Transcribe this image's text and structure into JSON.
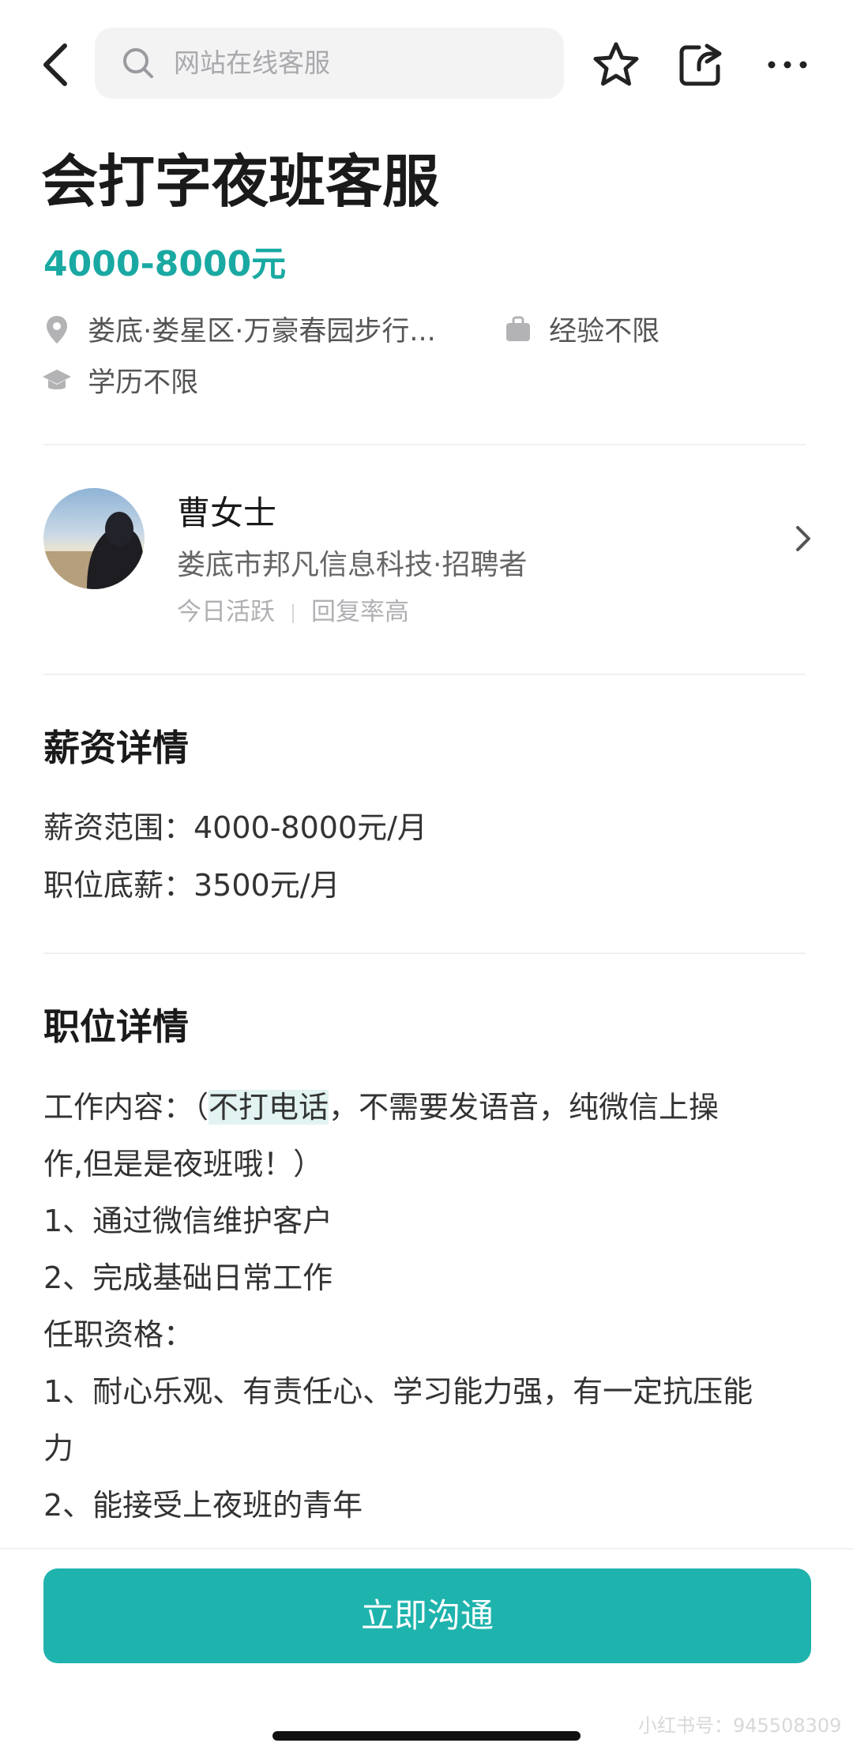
{
  "search": {
    "placeholder": "网站在线客服"
  },
  "job": {
    "title": "会打字夜班客服",
    "salary": "4000-8000元",
    "location": "娄底·娄星区·万豪春园步行...",
    "experience": "经验不限",
    "education": "学历不限"
  },
  "recruiter": {
    "name": "曹女士",
    "company": "娄底市邦凡信息科技·招聘者",
    "active": "今日活跃",
    "reply": "回复率高"
  },
  "salary_detail": {
    "title": "薪资详情",
    "range": "薪资范围：4000-8000元/月",
    "base": "职位底薪：3500元/月"
  },
  "job_detail": {
    "title": "职位详情",
    "content_prefix": "工作内容：（",
    "content_highlight": "不打电话",
    "content_rest": "，不需要发语音，纯微信上操",
    "content_line2": "作,但是是夜班哦！）",
    "duty1": "1、通过微信维护客户",
    "duty2": "2、完成基础日常工作",
    "req_title": "任职资格：",
    "req1_line1": "1、耐心乐观、有责任心、学习能力强，有一定抗压能",
    "req1_line2": "力",
    "req2": "2、能接受上夜班的青年"
  },
  "cta": {
    "label": "立即沟通"
  },
  "watermark": "小红书号：945508309",
  "colors": {
    "accent": "#19a9a2",
    "button": "#1fb3ad"
  },
  "icons": [
    "back-arrow-icon",
    "search-icon",
    "star-icon",
    "share-icon",
    "more-icon",
    "location-pin-icon",
    "briefcase-icon",
    "graduation-cap-icon",
    "chevron-right-icon"
  ]
}
